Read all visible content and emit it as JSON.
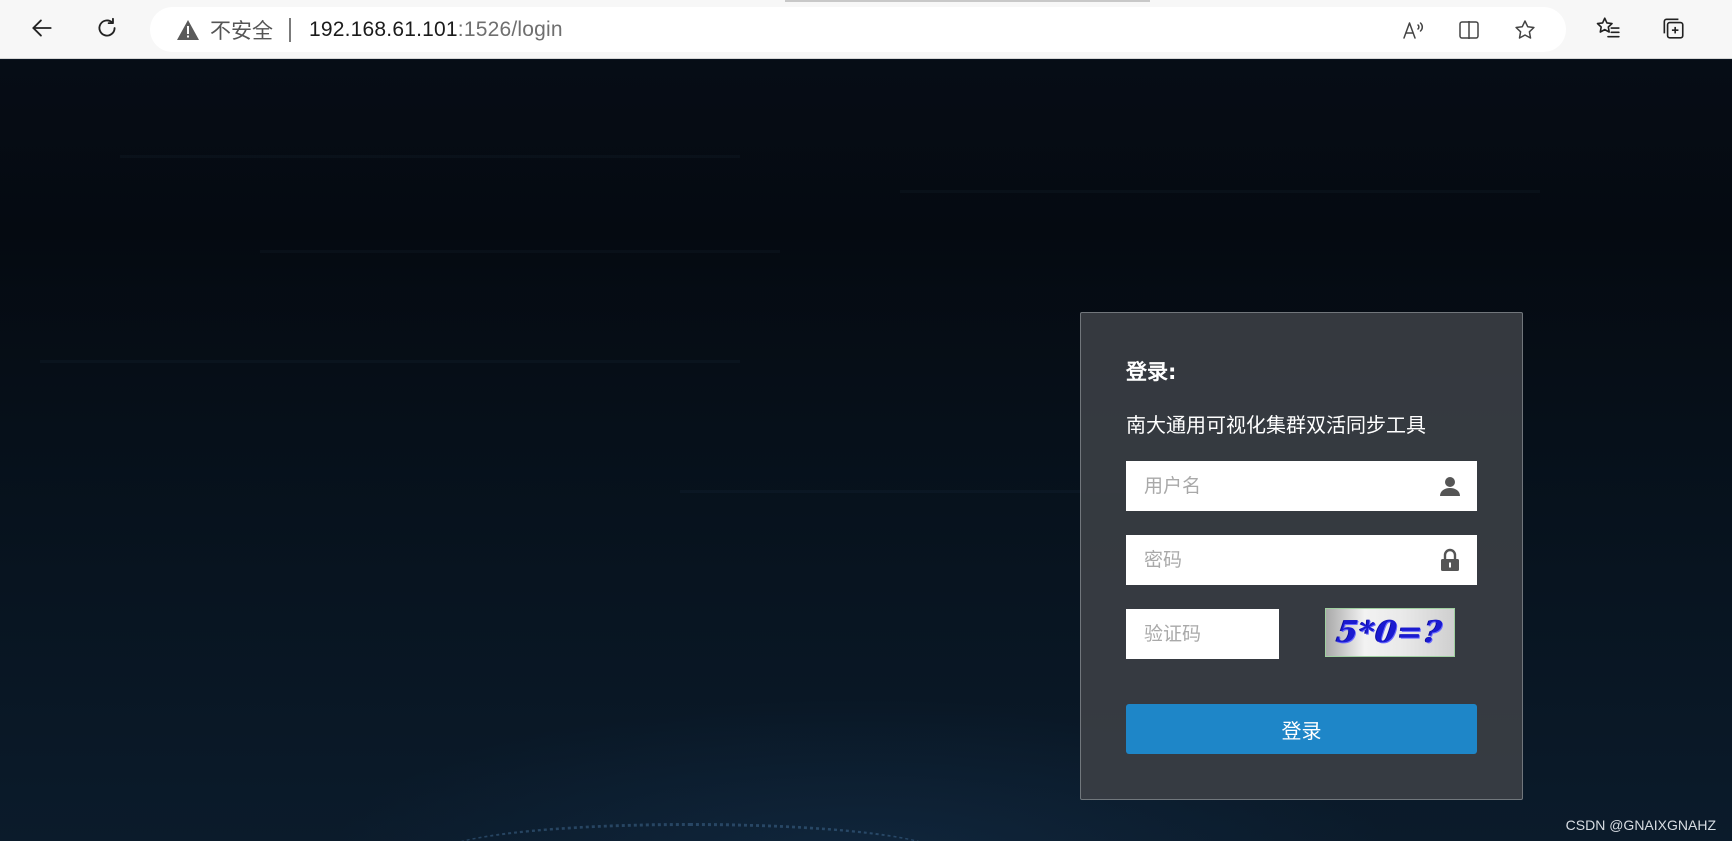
{
  "browser": {
    "security_label": "不安全",
    "url_host": "192.168.61.101",
    "url_path": ":1526/login",
    "icons": {
      "back": "back-arrow-icon",
      "refresh": "refresh-icon",
      "warning": "warning-triangle-icon",
      "read_aloud": "read-aloud-icon",
      "split_screen": "split-screen-icon",
      "favorite": "star-icon",
      "favorites_list": "favorites-list-icon",
      "collections": "collections-icon"
    }
  },
  "login": {
    "title": "登录:",
    "subtitle": "南大通用可视化集群双活同步工具",
    "username_placeholder": "用户名",
    "password_placeholder": "密码",
    "captcha_placeholder": "验证码",
    "captcha_text": "5*0=?",
    "submit_label": "登录"
  },
  "watermark": "CSDN @GNAIXGNAHZ",
  "colors": {
    "button_blue": "#1e86c8",
    "panel_bg": "#3c4046",
    "page_bg": "#060d16"
  }
}
